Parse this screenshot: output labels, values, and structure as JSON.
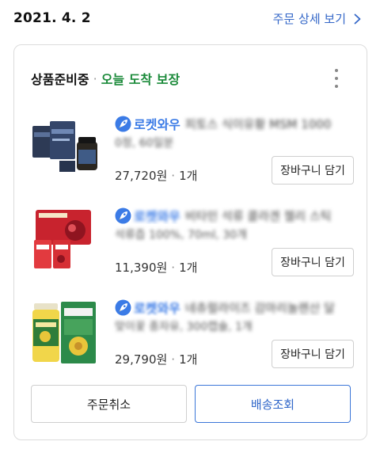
{
  "header": {
    "date": "2021. 4. 2",
    "detail_link": "주문 상세 보기"
  },
  "order": {
    "status": "상품준비중",
    "status_separator": "·",
    "delivery_guarantee": "오늘 도착 보장",
    "colors": {
      "accent_blue": "#3467c8",
      "rocket_blue": "#3b7be6",
      "status_green": "#1b8a3a"
    }
  },
  "items": [
    {
      "badge": "로켓와우",
      "title_line1": "피토스 식이유황 MSM 1000",
      "title_line2": "0정, 60일분",
      "price": "27,720원",
      "qty": "1개",
      "cart_label": "장바구니 담기",
      "icon": "rocket-icon"
    },
    {
      "badge": "로켓와우",
      "title_line1": "비타민 석류 콜라겐 젤리 스틱",
      "title_line2": "석류즙 100%, 70ml, 30개",
      "price": "11,390원",
      "qty": "1개",
      "cart_label": "장바구니 담기",
      "icon": "rocket-icon"
    },
    {
      "badge": "로켓와우",
      "title_line1": "네츄럴라이즈 감마리놀렌산 달",
      "title_line2": "맞이꽃 종자유, 300캡슐, 1개",
      "price": "29,790원",
      "qty": "1개",
      "cart_label": "장바구니 담기",
      "icon": "rocket-icon"
    }
  ],
  "actions": {
    "cancel_label": "주문취소",
    "track_label": "배송조회"
  }
}
